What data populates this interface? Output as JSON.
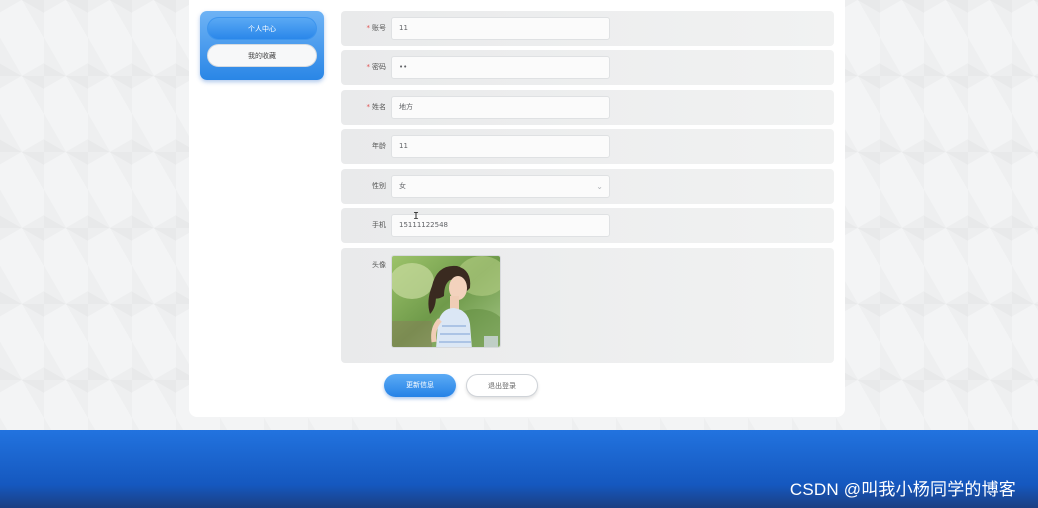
{
  "sidebar": {
    "items": [
      {
        "label": "个人中心",
        "active": true
      },
      {
        "label": "我的收藏",
        "active": false
      }
    ]
  },
  "form": {
    "account": {
      "label": "账号",
      "required": true,
      "value": "11"
    },
    "password": {
      "label": "密码",
      "required": true,
      "value": "••"
    },
    "name": {
      "label": "姓名",
      "required": true,
      "value": "地方"
    },
    "age": {
      "label": "年龄",
      "required": false,
      "value": "11"
    },
    "gender": {
      "label": "性别",
      "required": false,
      "value": "女"
    },
    "phone": {
      "label": "手机",
      "required": false,
      "value": "15111122548"
    },
    "avatar": {
      "label": "头像",
      "required": false
    }
  },
  "buttons": {
    "update": "更新信息",
    "logout": "退出登录"
  },
  "footer": {
    "watermark": "CSDN @叫我小杨同学的博客"
  },
  "colors": {
    "primary": "#2a86e6",
    "footer": "#1558bf",
    "required": "#e05050"
  }
}
